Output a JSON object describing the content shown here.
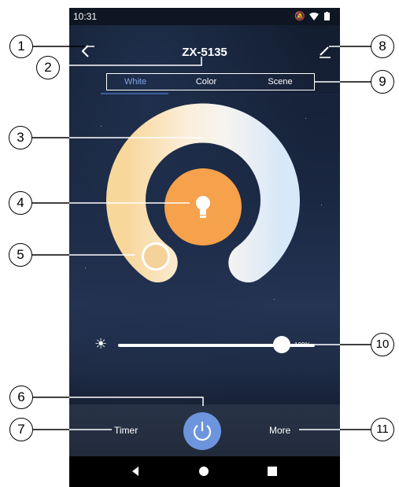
{
  "status_bar": {
    "time": "10:31",
    "icons": [
      "mute-icon",
      "wifi-icon",
      "battery-icon"
    ]
  },
  "header": {
    "title": "ZX-5135",
    "back_icon": "chevron-left-icon",
    "edit_icon": "edit-pencil-icon"
  },
  "tabs": [
    {
      "label": "White",
      "active": true
    },
    {
      "label": "Color",
      "active": false
    },
    {
      "label": "Scene",
      "active": false
    }
  ],
  "dial": {
    "warm_color": "#fce7be",
    "cool_color": "#dcebf9",
    "center_color": "#f6a14c",
    "center_icon": "lightbulb-icon"
  },
  "brightness": {
    "icon": "sun-icon",
    "value_label": "100%",
    "level": 0.83
  },
  "bottom_bar": {
    "timer_label": "Timer",
    "more_label": "More",
    "power_icon": "power-icon",
    "power_color": "#6d95de"
  },
  "nav_bar": {
    "icons": [
      "back-triangle-icon",
      "home-circle-icon",
      "recents-square-icon"
    ]
  },
  "callouts": [
    "1",
    "2",
    "3",
    "4",
    "5",
    "6",
    "7",
    "8",
    "9",
    "10",
    "11"
  ]
}
